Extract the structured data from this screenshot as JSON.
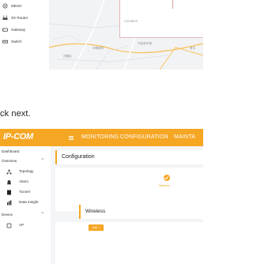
{
  "top_screenshot": {
    "device_list": [
      {
        "label": "MESH",
        "icon": "mesh-icon"
      },
      {
        "label": "4G Router",
        "icon": "router-icon"
      },
      {
        "label": "Gateway",
        "icon": "gateway-icon"
      },
      {
        "label": "Switch",
        "icon": "switch-icon"
      }
    ],
    "location_placeholder": "Location",
    "map_labels": [
      "花都区",
      "华联城市",
      "乌克劳市场",
      "常平"
    ]
  },
  "instruction": "ck next.",
  "bottom_screenshot": {
    "logo": "IP-COM",
    "top_nav": [
      "MONITORING",
      "CONFIGURATION",
      "MAINTA"
    ],
    "sidebar": {
      "dashboard": "Dashboard",
      "overview_section": "Overview",
      "overview_items": [
        {
          "label": "Topology",
          "icon": "topology-icon"
        },
        {
          "label": "Alarm",
          "icon": "alarm-icon"
        },
        {
          "label": "Tunnel",
          "icon": "tunnel-icon"
        },
        {
          "label": "Data Insight",
          "icon": "data-insight-icon"
        }
      ],
      "device_section": "Device",
      "device_items": [
        {
          "label": "AP",
          "icon": "ap-icon"
        }
      ]
    },
    "config_title": "Configuration",
    "step_label": "Wireless",
    "wireless_card_title": "Wireless",
    "add_button": "Add +"
  },
  "colors": {
    "accent": "#f5a623",
    "background": "#f4f5f7"
  }
}
